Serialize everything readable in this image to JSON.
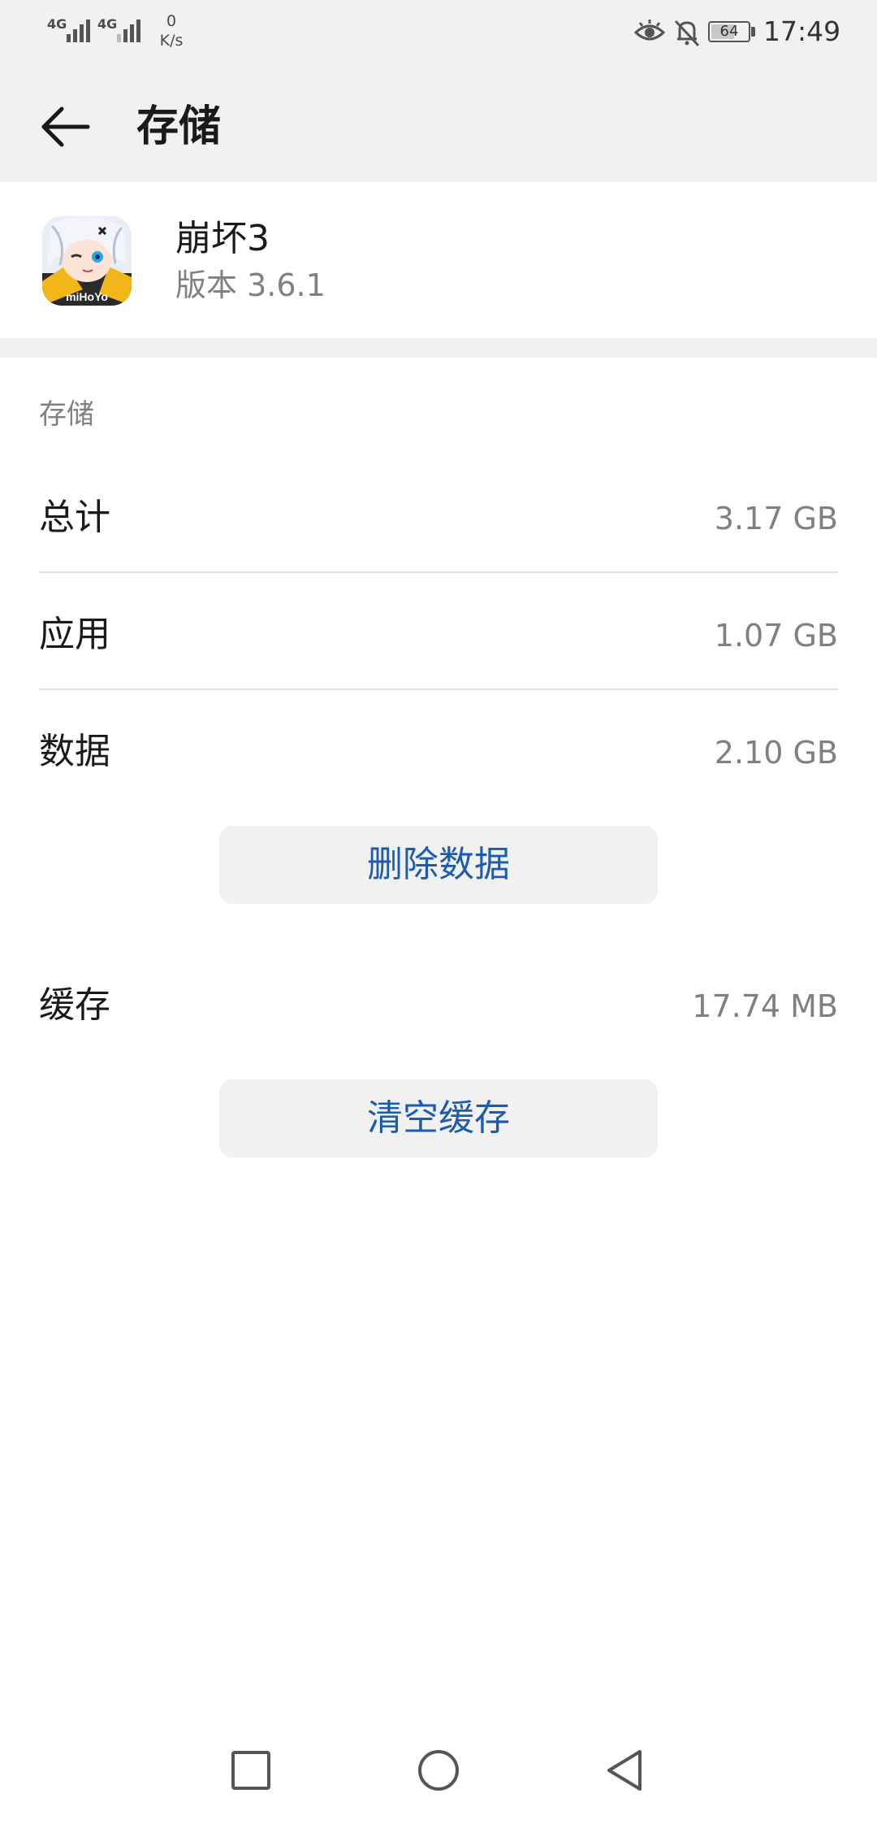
{
  "status_bar": {
    "network_1": "4G",
    "network_2": "4G",
    "speed_value": "0",
    "speed_unit": "K/s",
    "battery_level": "64",
    "battery_fraction": 0.64,
    "time": "17:49",
    "icons": [
      "eye-comfort-icon",
      "bell-muted-icon",
      "battery-icon"
    ]
  },
  "header": {
    "title": "存储",
    "back_icon": "arrow-left-icon"
  },
  "app": {
    "name": "崩坏3",
    "version": "版本 3.6.1",
    "icon_text": "miHoYo"
  },
  "storage": {
    "section_title": "存储",
    "rows": [
      {
        "label": "总计",
        "value": "3.17 GB"
      },
      {
        "label": "应用",
        "value": "1.07 GB"
      },
      {
        "label": "数据",
        "value": "2.10 GB"
      }
    ],
    "clear_data_button": "删除数据",
    "cache": {
      "label": "缓存",
      "value": "17.74 MB"
    },
    "clear_cache_button": "清空缓存"
  },
  "nav": {
    "recents_icon": "square-icon",
    "home_icon": "circle-icon",
    "back_icon": "triangle-back-icon"
  },
  "colors": {
    "accent": "#1a5cb0",
    "background_gray": "#f1f1f1",
    "secondary_text": "#808080"
  }
}
